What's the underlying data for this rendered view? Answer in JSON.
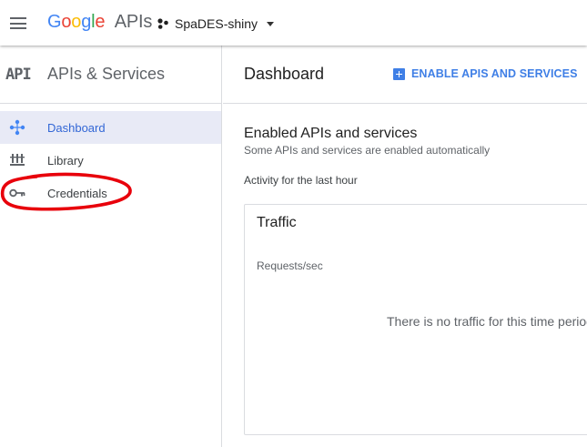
{
  "topbar": {
    "logo": {
      "google": [
        "G",
        "o",
        "o",
        "g",
        "l",
        "e"
      ],
      "google_colors": [
        "#4285f4",
        "#ea4335",
        "#fbbc05",
        "#4285f4",
        "#34a853",
        "#ea4335"
      ],
      "suffix": "APIs"
    },
    "project": {
      "name": "SpaDES-shiny",
      "icon": "project-dots-icon"
    },
    "menu_icon": "hamburger-menu-icon"
  },
  "sidebar": {
    "mark": "API",
    "title": "APIs & Services",
    "items": [
      {
        "label": "Dashboard",
        "icon": "dashboard-icon",
        "active": true
      },
      {
        "label": "Library",
        "icon": "library-icon",
        "active": false
      },
      {
        "label": "Credentials",
        "icon": "key-icon",
        "active": false
      }
    ]
  },
  "main": {
    "title": "Dashboard",
    "enable_button": "ENABLE APIS AND SERVICES",
    "section_title": "Enabled APIs and services",
    "section_subtitle": "Some APIs and services are enabled automatically",
    "activity_label": "Activity for the last hour",
    "traffic_card": {
      "title": "Traffic",
      "y_label": "Requests/sec",
      "empty_message": "There is no traffic for this time period"
    }
  },
  "colors": {
    "accent": "#3f7fe6",
    "active_nav_bg": "#e8eaf6",
    "annotation": "#e8000b"
  }
}
